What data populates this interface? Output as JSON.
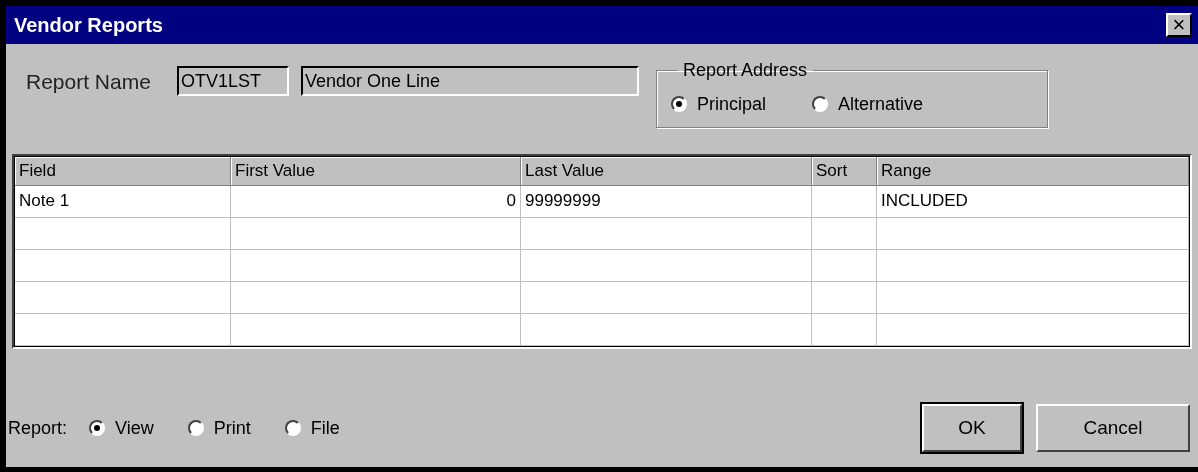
{
  "window": {
    "title": "Vendor Reports",
    "close": "×"
  },
  "report_name": {
    "label": "Report Name",
    "code": "OTV1LST",
    "name": "Vendor One Line"
  },
  "report_address": {
    "label": "Report Address",
    "options": [
      {
        "label": "Principal",
        "selected": true
      },
      {
        "label": "Alternative",
        "selected": false
      }
    ]
  },
  "table": {
    "columns": [
      "Field",
      "First Value",
      "Last Value",
      "Sort",
      "Range"
    ],
    "rows": [
      [
        "Note 1",
        "0",
        "99999999",
        "",
        "INCLUDED"
      ]
    ]
  },
  "report_output": {
    "label": "Report:",
    "options": [
      {
        "label": "View",
        "selected": true
      },
      {
        "label": "Print",
        "selected": false
      },
      {
        "label": "File",
        "selected": false
      }
    ]
  },
  "buttons": [
    {
      "label": "OK",
      "default": true
    },
    {
      "label": "Cancel",
      "default": false
    }
  ]
}
